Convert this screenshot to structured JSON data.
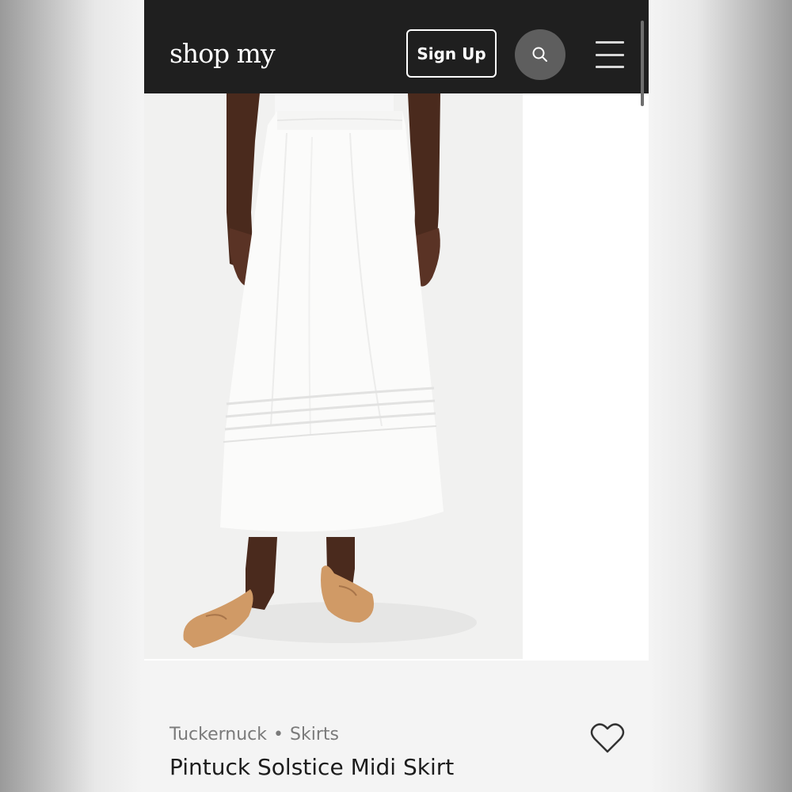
{
  "header": {
    "logo": "shop my",
    "signup_label": "Sign Up"
  },
  "icons": {
    "search": "search-icon",
    "menu": "hamburger-menu-icon",
    "favorite": "heart-icon"
  },
  "product": {
    "brand": "Tuckernuck",
    "separator": "•",
    "category": "Skirts",
    "name": "Pintuck Solstice Midi Skirt"
  },
  "colors": {
    "header_bg": "#1f1f1f",
    "search_bg": "#5e5e5e",
    "info_bg": "#f4f4f4",
    "skirt": "#fbfbfa",
    "shoe": "#d09a66"
  }
}
